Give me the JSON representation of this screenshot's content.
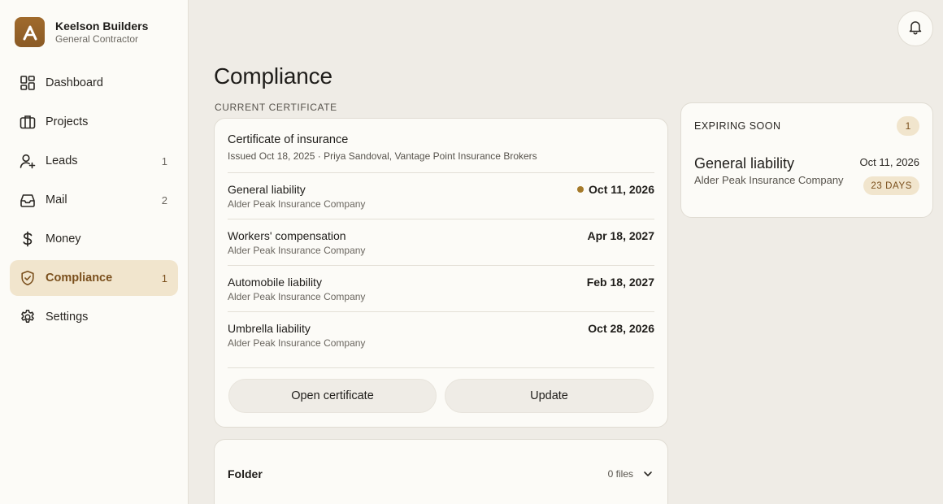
{
  "brand": {
    "name": "Keelson Builders",
    "subtitle": "General Contractor",
    "logo_icon": "a-logo-icon"
  },
  "sidebar": {
    "items": [
      {
        "label": "Dashboard",
        "icon": "dashboard-icon",
        "count": ""
      },
      {
        "label": "Projects",
        "icon": "briefcase-icon",
        "count": ""
      },
      {
        "label": "Leads",
        "icon": "user-plus-icon",
        "count": "1"
      },
      {
        "label": "Mail",
        "icon": "inbox-icon",
        "count": "2"
      },
      {
        "label": "Money",
        "icon": "dollar-icon",
        "count": ""
      },
      {
        "label": "Compliance",
        "icon": "shield-check-icon",
        "count": "1",
        "active": true
      },
      {
        "label": "Settings",
        "icon": "gear-icon",
        "count": ""
      }
    ]
  },
  "header": {
    "bell_icon": "bell-icon"
  },
  "main": {
    "title": "Compliance",
    "section_label": "CURRENT CERTIFICATE",
    "certificate": {
      "title": "Certificate of insurance",
      "meta": "Issued Oct 18, 2025 · Priya Sandoval, Vantage Point Insurance Brokers",
      "policies": [
        {
          "name": "General liability",
          "company": "Alder Peak Insurance Company",
          "date": "Oct 11, 2026",
          "flag": true
        },
        {
          "name": "Workers' compensation",
          "company": "Alder Peak Insurance Company",
          "date": "Apr 18, 2027",
          "flag": false
        },
        {
          "name": "Automobile liability",
          "company": "Alder Peak Insurance Company",
          "date": "Feb 18, 2027",
          "flag": false
        },
        {
          "name": "Umbrella liability",
          "company": "Alder Peak Insurance Company",
          "date": "Oct 28, 2026",
          "flag": false
        }
      ],
      "open_label": "Open certificate",
      "update_label": "Update"
    },
    "folder": {
      "title": "Folder",
      "count": "0 files"
    }
  },
  "expiring": {
    "label": "EXPIRING SOON",
    "badge": "1",
    "item": {
      "name": "General liability",
      "company": "Alder Peak Insurance Company",
      "date": "Oct 11, 2026",
      "days": "23 DAYS"
    }
  },
  "colors": {
    "accent": "#7a4f1c",
    "accent_bg": "#f1e5cd",
    "brand": "#8a5a25",
    "flag_dot": "#a57a2a"
  }
}
